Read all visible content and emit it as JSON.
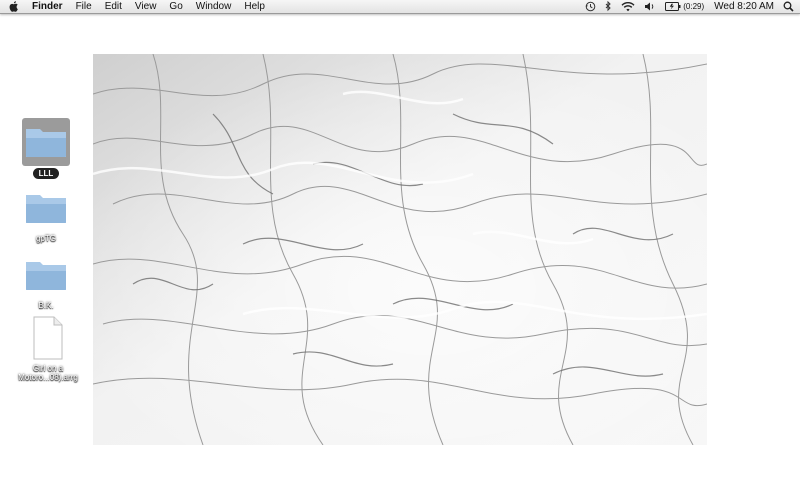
{
  "menubar": {
    "apple_icon": "apple-icon",
    "items": [
      "Finder",
      "File",
      "Edit",
      "View",
      "Go",
      "Window",
      "Help"
    ],
    "status_icons": [
      "time-machine-icon",
      "bluetooth-icon",
      "wifi-icon",
      "volume-icon",
      "battery-icon"
    ],
    "battery_time": "(0:29)",
    "clock": "Wed 8:20 AM",
    "spotlight_icon": "search-icon"
  },
  "desktop": {
    "items": [
      {
        "label": "LLL",
        "kind": "folder",
        "selected": true
      },
      {
        "label": "gpTG",
        "kind": "folder",
        "selected": false
      },
      {
        "label": "B.K.",
        "kind": "folder",
        "selected": false
      },
      {
        "label_line1": "Girl on a",
        "label_line2": "Motoro...08).arrg",
        "kind": "document",
        "selected": false
      }
    ]
  },
  "colors": {
    "folder": "#8fb6dc",
    "folder_tab": "#a9c9e8",
    "selection": "#9b9b9b",
    "label_selected_bg": "#222222"
  }
}
